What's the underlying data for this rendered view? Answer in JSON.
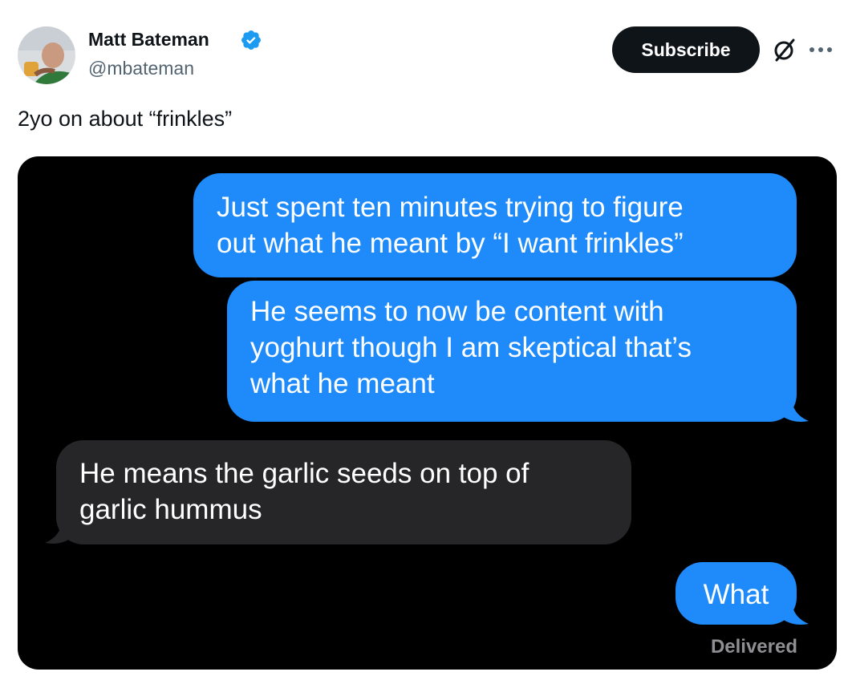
{
  "author": {
    "display_name": "Matt Bateman",
    "handle": "@mbateman",
    "avatar_icon": "user-avatar-photo",
    "verified_icon": "verified-badge-icon",
    "verified_color": "#1d9bf0"
  },
  "actions": {
    "subscribe_label": "Subscribe",
    "grok_icon": "grok-icon",
    "more_icon": "more-options-icon"
  },
  "tweet": {
    "text": "2yo on about “frinkles”"
  },
  "screenshot": {
    "messages": [
      {
        "direction": "outgoing",
        "text": "Just spent ten minutes trying to figure\nout what he meant by “I want frinkles”"
      },
      {
        "direction": "outgoing",
        "text": "He seems to now be content with\nyoghurt though I am skeptical that’s\nwhat he meant"
      },
      {
        "direction": "incoming",
        "text": "He means the garlic seeds on top of\ngarlic hummus"
      },
      {
        "direction": "outgoing",
        "text": "What"
      }
    ],
    "status": "Delivered",
    "colors": {
      "outgoing_bubble": "#1f8bfb",
      "incoming_bubble": "#262628",
      "background": "#000000"
    }
  }
}
